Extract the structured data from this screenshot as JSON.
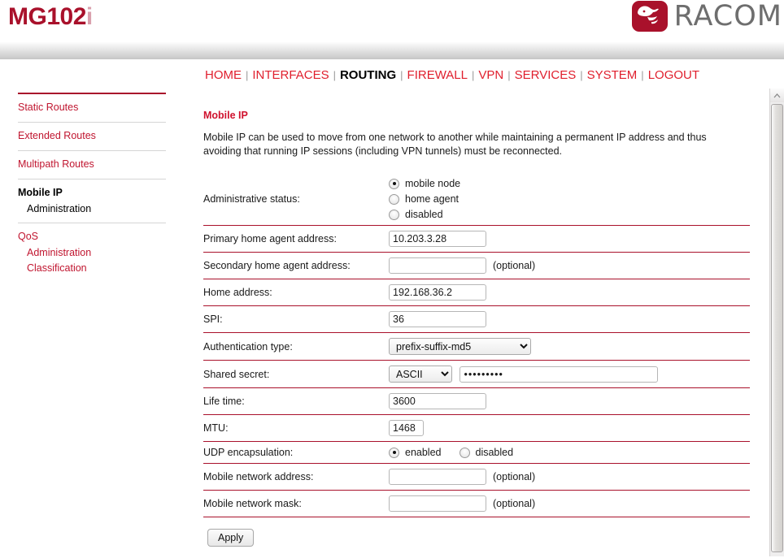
{
  "header": {
    "product_name": "MG102",
    "product_suffix": "i",
    "brand_name": "RACOM",
    "brand_color": "#a9112b",
    "logo_icon": "racom-bird-icon"
  },
  "topnav": {
    "separator": "|",
    "items": [
      {
        "label": "HOME",
        "active": false
      },
      {
        "label": "INTERFACES",
        "active": false
      },
      {
        "label": "ROUTING",
        "active": true
      },
      {
        "label": "FIREWALL",
        "active": false
      },
      {
        "label": "VPN",
        "active": false
      },
      {
        "label": "SERVICES",
        "active": false
      },
      {
        "label": "SYSTEM",
        "active": false
      },
      {
        "label": "LOGOUT",
        "active": false
      }
    ]
  },
  "sidebar": {
    "groups": [
      {
        "item": "Static Routes",
        "current": false,
        "subs": []
      },
      {
        "item": "Extended Routes",
        "current": false,
        "subs": []
      },
      {
        "item": "Multipath Routes",
        "current": false,
        "subs": []
      },
      {
        "item": "Mobile IP",
        "current": true,
        "subs": [
          {
            "label": "Administration",
            "current": true
          }
        ]
      },
      {
        "item": "QoS",
        "current": false,
        "subs": [
          {
            "label": "Administration",
            "current": false
          },
          {
            "label": "Classification",
            "current": false
          }
        ]
      }
    ]
  },
  "content": {
    "title": "Mobile IP",
    "description": "Mobile IP can be used to move from one network to another while maintaining a permanent IP address and thus avoiding that running IP sessions (including VPN tunnels) must be reconnected.",
    "optional_note": "(optional)",
    "apply_label": "Apply"
  },
  "form": {
    "admin_status": {
      "label": "Administrative status:",
      "options": [
        {
          "label": "mobile node",
          "checked": true
        },
        {
          "label": "home agent",
          "checked": false
        },
        {
          "label": "disabled",
          "checked": false
        }
      ]
    },
    "primary_home_agent": {
      "label": "Primary home agent address:",
      "value": "10.203.3.28",
      "placeholder": ""
    },
    "secondary_home_agent": {
      "label": "Secondary home agent address:",
      "value": "",
      "placeholder": "",
      "note": "(optional)"
    },
    "home_address": {
      "label": "Home address:",
      "value": "192.168.36.2",
      "placeholder": ""
    },
    "spi": {
      "label": "SPI:",
      "value": "36",
      "placeholder": ""
    },
    "auth_type": {
      "label": "Authentication type:",
      "value": "prefix-suffix-md5"
    },
    "shared_secret": {
      "label": "Shared secret:",
      "encoding": "ASCII",
      "value": "•••••••••",
      "placeholder": ""
    },
    "life_time": {
      "label": "Life time:",
      "value": "3600",
      "placeholder": ""
    },
    "mtu": {
      "label": "MTU:",
      "value": "1468",
      "placeholder": ""
    },
    "udp_encapsulation": {
      "label": "UDP encapsulation:",
      "options": [
        {
          "label": "enabled",
          "checked": true
        },
        {
          "label": "disabled",
          "checked": false
        }
      ]
    },
    "mobile_network_address": {
      "label": "Mobile network address:",
      "value": "",
      "placeholder": "",
      "note": "(optional)"
    },
    "mobile_network_mask": {
      "label": "Mobile network mask:",
      "value": "",
      "placeholder": "",
      "note": "(optional)"
    }
  },
  "scrollbar": {
    "up_icon": "chevron-up-icon"
  }
}
